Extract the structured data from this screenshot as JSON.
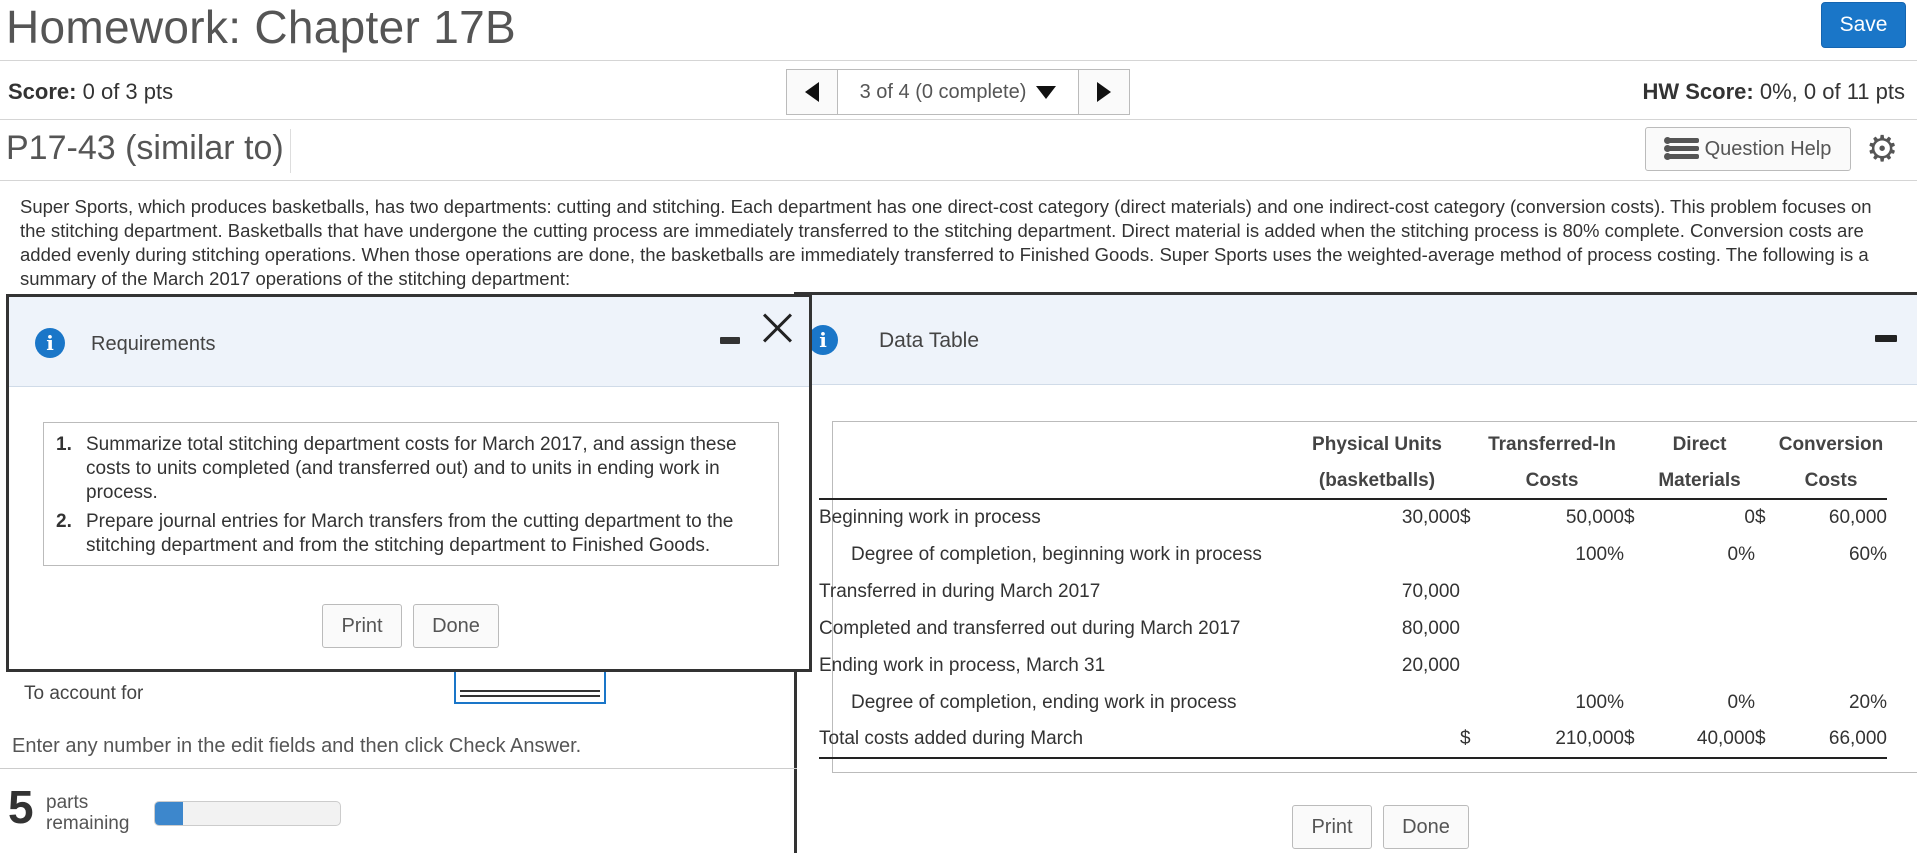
{
  "header": {
    "title": "Homework: Chapter 17B",
    "save_label": "Save"
  },
  "score_bar": {
    "score_label": "Score:",
    "score_value": "0 of 3 pts",
    "nav_position": "3 of 4 (0 complete)",
    "hw_score_label": "HW Score:",
    "hw_score_value": "0%, 0 of 11 pts"
  },
  "question": {
    "id": "P17-43 (similar to)",
    "help_label": "Question Help"
  },
  "problem_text": "Super Sports, which produces basketballs, has two departments: cutting and stitching. Each department has one direct-cost category (direct materials) and one indirect-cost category (conversion costs). This problem focuses on the stitching department. Basketballs that have undergone the cutting process are immediately transferred to the stitching department. Direct material is added when the stitching process is 80% complete. Conversion costs are added evenly during stitching operations. When those operations are done, the basketballs are immediately transferred to Finished Goods. Super Sports uses the weighted-average method of process costing. The following is a summary of the March 2017 operations of the stitching department:",
  "work_area": {
    "account_label": "To account for",
    "instruction": "Enter any number in the edit fields and then click Check Answer.",
    "parts_count": "5",
    "parts_label_line1": "parts",
    "parts_label_line2": "remaining",
    "progress_fraction": 0.15
  },
  "requirements_dialog": {
    "title": "Requirements",
    "items": [
      {
        "num": "1.",
        "text": "Summarize total stitching department costs for March 2017, and assign these costs to units completed (and transferred out) and to units in ending work in process."
      },
      {
        "num": "2.",
        "text": "Prepare journal entries for March transfers from the cutting department to the stitching department and from the stitching department to Finished Goods."
      }
    ],
    "print_label": "Print",
    "done_label": "Done"
  },
  "data_table_dialog": {
    "title": "Data Table",
    "columns": {
      "physical_line1": "Physical Units",
      "physical_line2": "(basketballs)",
      "transferred_line1": "Transferred-In",
      "transferred_line2": "Costs",
      "direct_line1": "Direct",
      "direct_line2": "Materials",
      "conversion_line1": "Conversion",
      "conversion_line2": "Costs"
    },
    "rows": [
      {
        "label": "Beginning work in process",
        "physical": "30,000",
        "d1": "$",
        "transferred": "50,000",
        "d2": "$",
        "direct": "0",
        "d3": "$",
        "conversion": "60,000"
      },
      {
        "label": "Degree of completion, beginning work in process",
        "physical": "",
        "d1": "",
        "transferred": "100%",
        "d2": "",
        "direct": "0%",
        "d3": "",
        "conversion": "60%"
      },
      {
        "label": "Transferred in during March 2017",
        "physical": "70,000",
        "d1": "",
        "transferred": "",
        "d2": "",
        "direct": "",
        "d3": "",
        "conversion": ""
      },
      {
        "label": "Completed and transferred out during March 2017",
        "physical": "80,000",
        "d1": "",
        "transferred": "",
        "d2": "",
        "direct": "",
        "d3": "",
        "conversion": ""
      },
      {
        "label": "Ending work in process, March 31",
        "physical": "20,000",
        "d1": "",
        "transferred": "",
        "d2": "",
        "direct": "",
        "d3": "",
        "conversion": ""
      },
      {
        "label": "Degree of completion, ending work in process",
        "physical": "",
        "d1": "",
        "transferred": "100%",
        "d2": "",
        "direct": "0%",
        "d3": "",
        "conversion": "20%"
      },
      {
        "label": "Total costs added during March",
        "physical": "",
        "d1": "$",
        "transferred": "210,000",
        "d2": "$",
        "direct": "40,000",
        "d3": "$",
        "conversion": "66,000"
      }
    ],
    "print_label": "Print",
    "done_label": "Done"
  }
}
